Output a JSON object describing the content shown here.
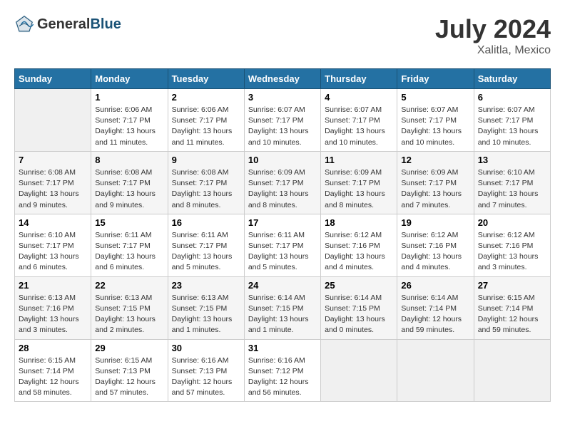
{
  "header": {
    "logo_general": "General",
    "logo_blue": "Blue",
    "title": "July 2024",
    "location": "Xalitla, Mexico"
  },
  "weekdays": [
    "Sunday",
    "Monday",
    "Tuesday",
    "Wednesday",
    "Thursday",
    "Friday",
    "Saturday"
  ],
  "weeks": [
    [
      {
        "day": "",
        "empty": true
      },
      {
        "day": "1",
        "sunrise": "Sunrise: 6:06 AM",
        "sunset": "Sunset: 7:17 PM",
        "daylight": "Daylight: 13 hours and 11 minutes."
      },
      {
        "day": "2",
        "sunrise": "Sunrise: 6:06 AM",
        "sunset": "Sunset: 7:17 PM",
        "daylight": "Daylight: 13 hours and 11 minutes."
      },
      {
        "day": "3",
        "sunrise": "Sunrise: 6:07 AM",
        "sunset": "Sunset: 7:17 PM",
        "daylight": "Daylight: 13 hours and 10 minutes."
      },
      {
        "day": "4",
        "sunrise": "Sunrise: 6:07 AM",
        "sunset": "Sunset: 7:17 PM",
        "daylight": "Daylight: 13 hours and 10 minutes."
      },
      {
        "day": "5",
        "sunrise": "Sunrise: 6:07 AM",
        "sunset": "Sunset: 7:17 PM",
        "daylight": "Daylight: 13 hours and 10 minutes."
      },
      {
        "day": "6",
        "sunrise": "Sunrise: 6:07 AM",
        "sunset": "Sunset: 7:17 PM",
        "daylight": "Daylight: 13 hours and 10 minutes."
      }
    ],
    [
      {
        "day": "7",
        "sunrise": "Sunrise: 6:08 AM",
        "sunset": "Sunset: 7:17 PM",
        "daylight": "Daylight: 13 hours and 9 minutes."
      },
      {
        "day": "8",
        "sunrise": "Sunrise: 6:08 AM",
        "sunset": "Sunset: 7:17 PM",
        "daylight": "Daylight: 13 hours and 9 minutes."
      },
      {
        "day": "9",
        "sunrise": "Sunrise: 6:08 AM",
        "sunset": "Sunset: 7:17 PM",
        "daylight": "Daylight: 13 hours and 8 minutes."
      },
      {
        "day": "10",
        "sunrise": "Sunrise: 6:09 AM",
        "sunset": "Sunset: 7:17 PM",
        "daylight": "Daylight: 13 hours and 8 minutes."
      },
      {
        "day": "11",
        "sunrise": "Sunrise: 6:09 AM",
        "sunset": "Sunset: 7:17 PM",
        "daylight": "Daylight: 13 hours and 8 minutes."
      },
      {
        "day": "12",
        "sunrise": "Sunrise: 6:09 AM",
        "sunset": "Sunset: 7:17 PM",
        "daylight": "Daylight: 13 hours and 7 minutes."
      },
      {
        "day": "13",
        "sunrise": "Sunrise: 6:10 AM",
        "sunset": "Sunset: 7:17 PM",
        "daylight": "Daylight: 13 hours and 7 minutes."
      }
    ],
    [
      {
        "day": "14",
        "sunrise": "Sunrise: 6:10 AM",
        "sunset": "Sunset: 7:17 PM",
        "daylight": "Daylight: 13 hours and 6 minutes."
      },
      {
        "day": "15",
        "sunrise": "Sunrise: 6:11 AM",
        "sunset": "Sunset: 7:17 PM",
        "daylight": "Daylight: 13 hours and 6 minutes."
      },
      {
        "day": "16",
        "sunrise": "Sunrise: 6:11 AM",
        "sunset": "Sunset: 7:17 PM",
        "daylight": "Daylight: 13 hours and 5 minutes."
      },
      {
        "day": "17",
        "sunrise": "Sunrise: 6:11 AM",
        "sunset": "Sunset: 7:17 PM",
        "daylight": "Daylight: 13 hours and 5 minutes."
      },
      {
        "day": "18",
        "sunrise": "Sunrise: 6:12 AM",
        "sunset": "Sunset: 7:16 PM",
        "daylight": "Daylight: 13 hours and 4 minutes."
      },
      {
        "day": "19",
        "sunrise": "Sunrise: 6:12 AM",
        "sunset": "Sunset: 7:16 PM",
        "daylight": "Daylight: 13 hours and 4 minutes."
      },
      {
        "day": "20",
        "sunrise": "Sunrise: 6:12 AM",
        "sunset": "Sunset: 7:16 PM",
        "daylight": "Daylight: 13 hours and 3 minutes."
      }
    ],
    [
      {
        "day": "21",
        "sunrise": "Sunrise: 6:13 AM",
        "sunset": "Sunset: 7:16 PM",
        "daylight": "Daylight: 13 hours and 3 minutes."
      },
      {
        "day": "22",
        "sunrise": "Sunrise: 6:13 AM",
        "sunset": "Sunset: 7:15 PM",
        "daylight": "Daylight: 13 hours and 2 minutes."
      },
      {
        "day": "23",
        "sunrise": "Sunrise: 6:13 AM",
        "sunset": "Sunset: 7:15 PM",
        "daylight": "Daylight: 13 hours and 1 minutes."
      },
      {
        "day": "24",
        "sunrise": "Sunrise: 6:14 AM",
        "sunset": "Sunset: 7:15 PM",
        "daylight": "Daylight: 13 hours and 1 minute."
      },
      {
        "day": "25",
        "sunrise": "Sunrise: 6:14 AM",
        "sunset": "Sunset: 7:15 PM",
        "daylight": "Daylight: 13 hours and 0 minutes."
      },
      {
        "day": "26",
        "sunrise": "Sunrise: 6:14 AM",
        "sunset": "Sunset: 7:14 PM",
        "daylight": "Daylight: 12 hours and 59 minutes."
      },
      {
        "day": "27",
        "sunrise": "Sunrise: 6:15 AM",
        "sunset": "Sunset: 7:14 PM",
        "daylight": "Daylight: 12 hours and 59 minutes."
      }
    ],
    [
      {
        "day": "28",
        "sunrise": "Sunrise: 6:15 AM",
        "sunset": "Sunset: 7:14 PM",
        "daylight": "Daylight: 12 hours and 58 minutes."
      },
      {
        "day": "29",
        "sunrise": "Sunrise: 6:15 AM",
        "sunset": "Sunset: 7:13 PM",
        "daylight": "Daylight: 12 hours and 57 minutes."
      },
      {
        "day": "30",
        "sunrise": "Sunrise: 6:16 AM",
        "sunset": "Sunset: 7:13 PM",
        "daylight": "Daylight: 12 hours and 57 minutes."
      },
      {
        "day": "31",
        "sunrise": "Sunrise: 6:16 AM",
        "sunset": "Sunset: 7:12 PM",
        "daylight": "Daylight: 12 hours and 56 minutes."
      },
      {
        "day": "",
        "empty": true
      },
      {
        "day": "",
        "empty": true
      },
      {
        "day": "",
        "empty": true
      }
    ]
  ]
}
